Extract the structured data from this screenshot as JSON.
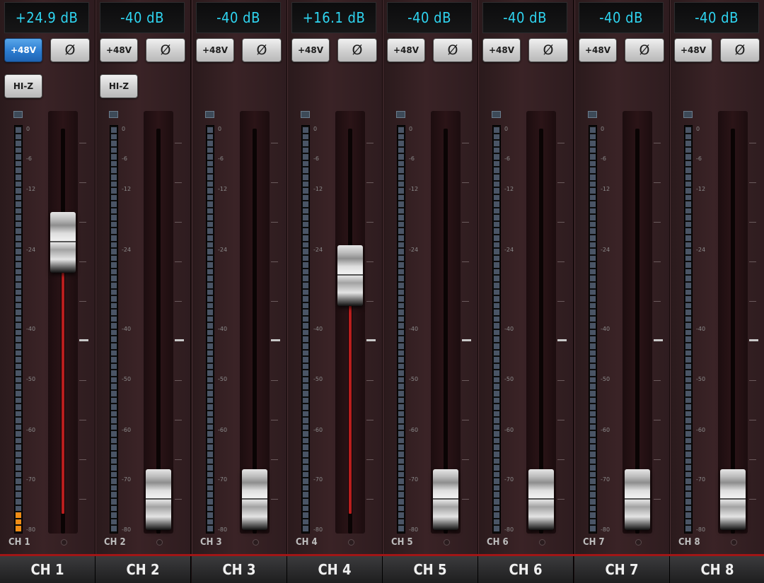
{
  "colors": {
    "gain_text": "#2fd6f2",
    "phantom_on": "#2c7cd0",
    "meter_segment": "#4a5566",
    "meter_lit": "#f08c16",
    "fader_fill": "#b81e1e",
    "accent_line": "#a11616"
  },
  "db_scale": [
    "0",
    "-6",
    "-12",
    "-24",
    "-40",
    "-50",
    "-60",
    "-70",
    "-80"
  ],
  "channels": [
    {
      "gain": "+24.9 dB",
      "phantom_label": "+48V",
      "phantom_on": true,
      "phase_icon": "Ø",
      "hiz_label": "HI-Z",
      "has_hiz": true,
      "fader_level": 0.75,
      "meter_lit_segments": 3,
      "label": "CH 1",
      "name": "CH 1"
    },
    {
      "gain": "-40 dB",
      "phantom_label": "+48V",
      "phantom_on": false,
      "phase_icon": "Ø",
      "hiz_label": "HI-Z",
      "has_hiz": true,
      "fader_level": 0.06,
      "meter_lit_segments": 0,
      "label": "CH 2",
      "name": "CH 2"
    },
    {
      "gain": "-40 dB",
      "phantom_label": "+48V",
      "phantom_on": false,
      "phase_icon": "Ø",
      "has_hiz": false,
      "fader_level": 0.06,
      "meter_lit_segments": 0,
      "label": "CH 3",
      "name": "CH 3"
    },
    {
      "gain": "+16.1 dB",
      "phantom_label": "+48V",
      "phantom_on": false,
      "phase_icon": "Ø",
      "has_hiz": false,
      "fader_level": 0.66,
      "meter_lit_segments": 0,
      "label": "CH 4",
      "name": "CH 4"
    },
    {
      "gain": "-40 dB",
      "phantom_label": "+48V",
      "phantom_on": false,
      "phase_icon": "Ø",
      "has_hiz": false,
      "fader_level": 0.06,
      "meter_lit_segments": 0,
      "label": "CH 5",
      "name": "CH 5"
    },
    {
      "gain": "-40 dB",
      "phantom_label": "+48V",
      "phantom_on": false,
      "phase_icon": "Ø",
      "has_hiz": false,
      "fader_level": 0.06,
      "meter_lit_segments": 0,
      "label": "CH 6",
      "name": "CH 6"
    },
    {
      "gain": "-40 dB",
      "phantom_label": "+48V",
      "phantom_on": false,
      "phase_icon": "Ø",
      "has_hiz": false,
      "fader_level": 0.06,
      "meter_lit_segments": 0,
      "label": "CH 7",
      "name": "CH 7"
    },
    {
      "gain": "-40 dB",
      "phantom_label": "+48V",
      "phantom_on": false,
      "phase_icon": "Ø",
      "has_hiz": false,
      "fader_level": 0.06,
      "meter_lit_segments": 0,
      "label": "CH 8",
      "name": "CH 8"
    }
  ]
}
